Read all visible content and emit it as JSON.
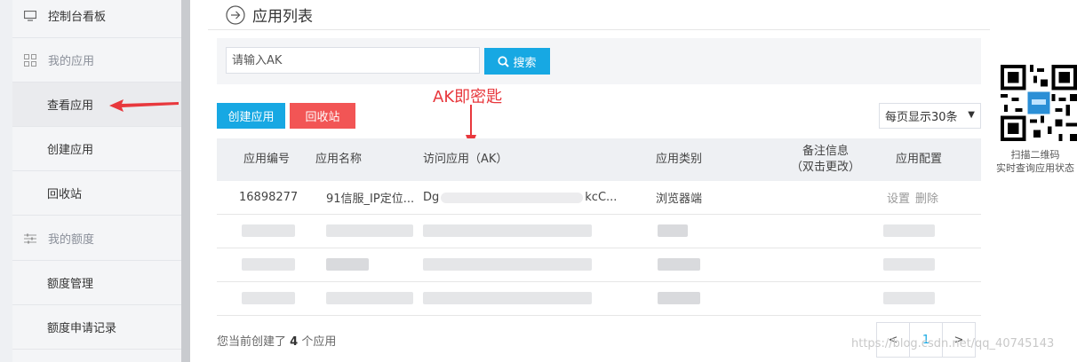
{
  "sidebar": {
    "items": [
      {
        "label": "控制台看板",
        "type": "group"
      },
      {
        "label": "我的应用",
        "type": "group"
      },
      {
        "label": "查看应用",
        "type": "child",
        "active": true
      },
      {
        "label": "创建应用",
        "type": "child"
      },
      {
        "label": "回收站",
        "type": "child"
      },
      {
        "label": "我的额度",
        "type": "group"
      },
      {
        "label": "额度管理",
        "type": "child"
      },
      {
        "label": "额度申请记录",
        "type": "child"
      }
    ]
  },
  "header": {
    "title": "应用列表"
  },
  "search": {
    "placeholder": "请输入AK",
    "button_label": "搜索"
  },
  "annotation": {
    "text": "AK即密匙",
    "color": "#e8383d"
  },
  "actions": {
    "create_label": "创建应用",
    "recycle_label": "回收站",
    "per_page": "每页显示30条"
  },
  "table": {
    "headers": [
      "应用编号",
      "应用名称",
      "访问应用（AK）",
      "应用类别",
      "备注信息",
      "（双击更改）",
      "应用配置"
    ],
    "rows": [
      {
        "id": "16898277",
        "name": "91信服_IP定位...",
        "ak_start": "Dg",
        "ak_end": "kcC...",
        "category": "浏览器端",
        "actions": [
          "设置",
          "删除"
        ]
      }
    ]
  },
  "footer": {
    "prefix": "您当前创建了",
    "count": "4",
    "suffix": "个应用"
  },
  "pagination": {
    "prev": "<",
    "current": "1",
    "next": ">"
  },
  "qr": {
    "caption_line1": "扫描二维码",
    "caption_line2": "实时查询应用状态"
  },
  "watermark": "https://blog.csdn.net/qq_40745143",
  "colors": {
    "primary": "#17a8e3",
    "danger": "#f25555",
    "annotation": "#e8383d"
  }
}
